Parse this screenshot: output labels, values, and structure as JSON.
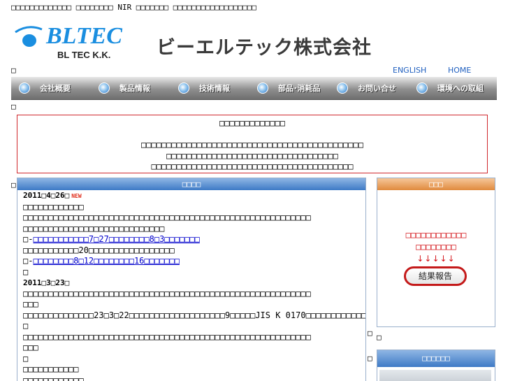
{
  "header": {
    "tagline": "□□□□□□□□□□□□□ □□□□□□□□ NIR □□□□□□□ □□□□□□□□□□□□□□□□□□",
    "logo_text": "BLTEC",
    "logo_sub": "BL TEC K.K.",
    "company_name": "ビーエルテック株式会社",
    "stray_char": "□",
    "links": {
      "english": "ENGLISH",
      "home": "HOME"
    }
  },
  "nav": {
    "items": [
      {
        "label": "会社概要"
      },
      {
        "label": "製品情報"
      },
      {
        "label": "技術情報"
      },
      {
        "label": "部品･消耗品"
      },
      {
        "label": "お問い合せ"
      },
      {
        "label": "環境への取組"
      }
    ]
  },
  "notice": {
    "title": "□□□□□□□□□□□□□",
    "line1": "□□□□□□□□□□□□□□□□□□□□□□□□□□□□□□□□□□□□□□□□□□□□",
    "line2": "□□□□□□□□□□□□□□□□□□□□□□□□□□□□□□□□□□",
    "line3": "□□□□□□□□□□□□□□□□□□□□□□□□□□□□□□□□□□□□□□□□"
  },
  "news": {
    "header": "□□□□",
    "date1": "2011□4□26□",
    "new_badge": "NEW",
    "l1": "□□□□□□□□□□□□",
    "l2": "□□□□□□□□□□□□□□□□□□□□□□□□□□□□□□□□□□□□□□□□□□□□□□□□□□□□□□□□□",
    "l3": "□□□□□□□□□□□□□□□□□□□□□□□□□□□□",
    "l4_prefix": "□-",
    "l4_link": "□□□□□□□□□□□7□27□□□□□□□□8□3□□□□□□□",
    "l5": "□□□□□□□□□□□20□□□□□□□□□□□□□□□□□",
    "l6_prefix": "□-",
    "l6_link": "□□□□□□□□8□12□□□□□□□□16□□□□□□□",
    "l7": "□",
    "date2": "2011□3□23□",
    "l8": "□□□□□□□□□□□□□□□□□□□□□□□□□□□□□□□□□□□□□□□□□□□□□□□□□□□□□□□□□",
    "l9": "□□□",
    "l10": "□□□□□□□□□□□□□□23□3□22□□□□□□□□□□□□□□□□□□□9□□□□□JIS K 0170□□□□□□□□□□□□□□□□□□",
    "l11": "□",
    "l12": "□□□□□□□□□□□□□□□□□□□□□□□□□□□□□□□□□□□□□□□□□□□□□□□□□□□□□□□□□",
    "l13": "□□□",
    "l14": "□",
    "l15": "□□□□□□□□□□□",
    "l16": "□□□□□□□□□□□□"
  },
  "sidebar": {
    "header": "□□□",
    "red1": "□□□□□□□□□□□□",
    "red2": "□□□□□□□□",
    "arrows": "↓↓↓↓↓",
    "result_button": "結果報告",
    "header2": "□□□□□□"
  }
}
